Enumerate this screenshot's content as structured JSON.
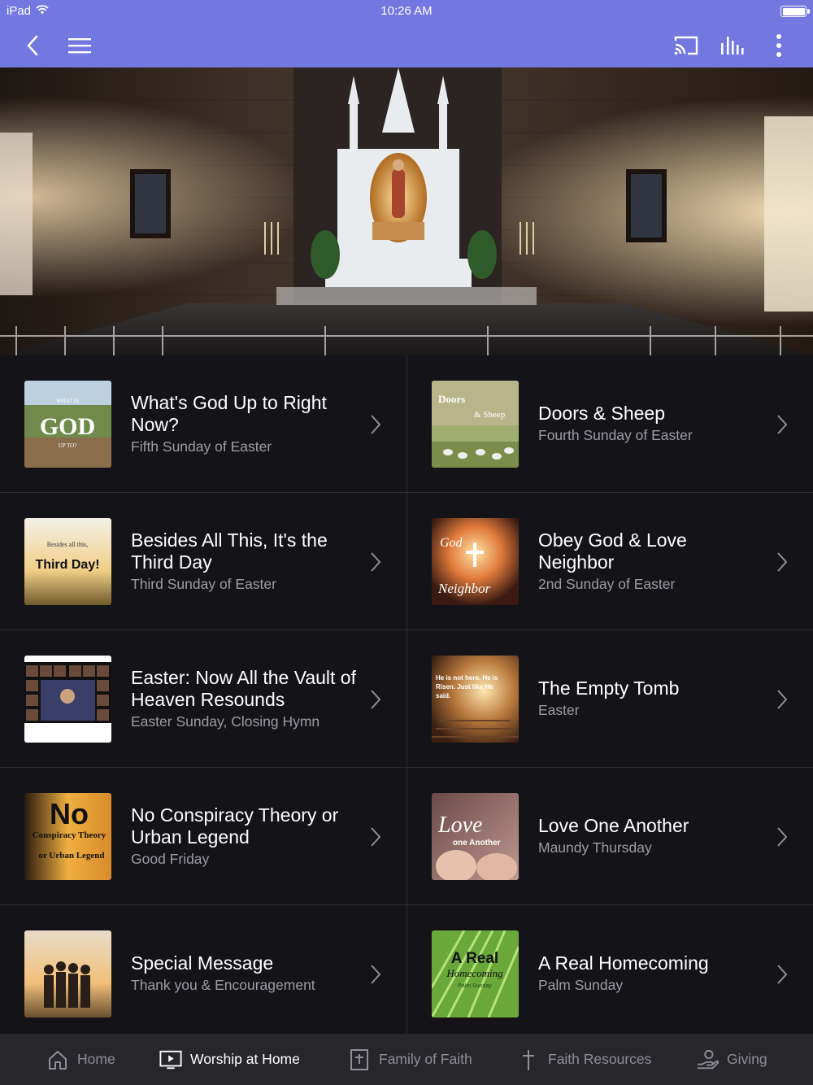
{
  "status": {
    "device": "iPad",
    "time": "10:26 AM"
  },
  "items": [
    {
      "title": "What's God Up to Right Now?",
      "subtitle": "Fifth Sunday of Easter",
      "thumb_text": "GOD",
      "thumb_small_top": "WHAT IS",
      "thumb_small_bottom": "UP TO?"
    },
    {
      "title": "Doors & Sheep",
      "subtitle": "Fourth Sunday of Easter",
      "thumb_text": "Doors",
      "thumb_small_top": "& Sheep"
    },
    {
      "title": "Besides All This, It's the Third Day",
      "subtitle": "Third Sunday of Easter",
      "thumb_text": "Third Day!",
      "thumb_small_top": "Besides all this,"
    },
    {
      "title": "Obey God & Love Neighbor",
      "subtitle": "2nd Sunday of Easter",
      "thumb_text": "Neighbor",
      "thumb_small_top": "God"
    },
    {
      "title": "Easter: Now All the Vault of Heaven Resounds",
      "subtitle": "Easter Sunday, Closing Hymn"
    },
    {
      "title": "The Empty Tomb",
      "subtitle": "Easter",
      "thumb_text": "He is not here. He is Risen. Just like He said."
    },
    {
      "title": "No Conspiracy Theory or Urban Legend",
      "subtitle": "Good Friday",
      "thumb_text": "No",
      "thumb_small_top": "Conspiracy Theory",
      "thumb_small_bottom": "or Urban Legend"
    },
    {
      "title": "Love One Another",
      "subtitle": "Maundy Thursday",
      "thumb_text": "Love",
      "thumb_small_top": "one Another"
    },
    {
      "title": "Special Message",
      "subtitle": "Thank you & Encouragement"
    },
    {
      "title": "A Real Homecoming",
      "subtitle": "Palm Sunday",
      "thumb_text": "A Real",
      "thumb_small_top": "Homecoming",
      "thumb_small_bottom": "Palm Sunday"
    }
  ],
  "tabs": [
    {
      "label": "Home",
      "icon": "home-icon",
      "active": false
    },
    {
      "label": "Worship at Home",
      "icon": "tv-play-icon",
      "active": true
    },
    {
      "label": "Family of Faith",
      "icon": "bible-icon",
      "active": false
    },
    {
      "label": "Faith Resources",
      "icon": "cross-icon",
      "active": false
    },
    {
      "label": "Giving",
      "icon": "giving-hand-icon",
      "active": false
    }
  ],
  "colors": {
    "accent": "#7377e0",
    "background": "#141418",
    "tabbar": "#26262b",
    "subtitle": "#9b9ba3"
  }
}
